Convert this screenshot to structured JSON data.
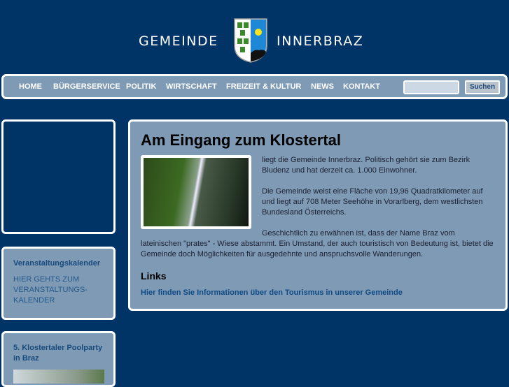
{
  "header": {
    "left_word": "GEMEINDE",
    "right_word": "INNERBRAZ"
  },
  "nav": {
    "items": [
      "HOME",
      "BÜRGERSERVICE",
      "POLITIK",
      "WIRTSCHAFT",
      "FREIZEIT & KULTUR",
      "NEWS",
      "KONTAKT"
    ],
    "search_value": "",
    "search_button": "Suchen"
  },
  "sidebar": {
    "calendar": {
      "title": "Veranstaltungskalender",
      "link": "HIER GEHTS ZUM VERANSTALTUNGS-KALENDER"
    },
    "event": {
      "title": "5. Klostertaler Poolparty in Braz"
    }
  },
  "main": {
    "title": "Am Eingang zum Klostertal",
    "paragraphs": [
      "liegt die Gemeinde Innerbraz. Politisch gehört sie zum Bezirk Bludenz und hat derzeit ca. 1.000 Einwohner.",
      "Die Gemeinde weist eine Fläche von 19,96 Quadratkilometer auf und liegt auf 708 Meter Seehöhe in Vorarlberg, dem westlichsten Bundesland Österreichs.",
      "Geschichtlich zu erwähnen ist, dass der Name Braz vom lateinischen \"prates\" - Wiese abstammt. Ein Umstand, der auch touristisch von Bedeutung ist, bietet die Gemeinde doch Möglichkeiten für ausgedehnte und anspruchsvolle Wanderungen."
    ],
    "links_heading": "Links",
    "tourism_link": "Hier finden Sie Informationen über den Tourismus in unserer Gemeinde"
  }
}
